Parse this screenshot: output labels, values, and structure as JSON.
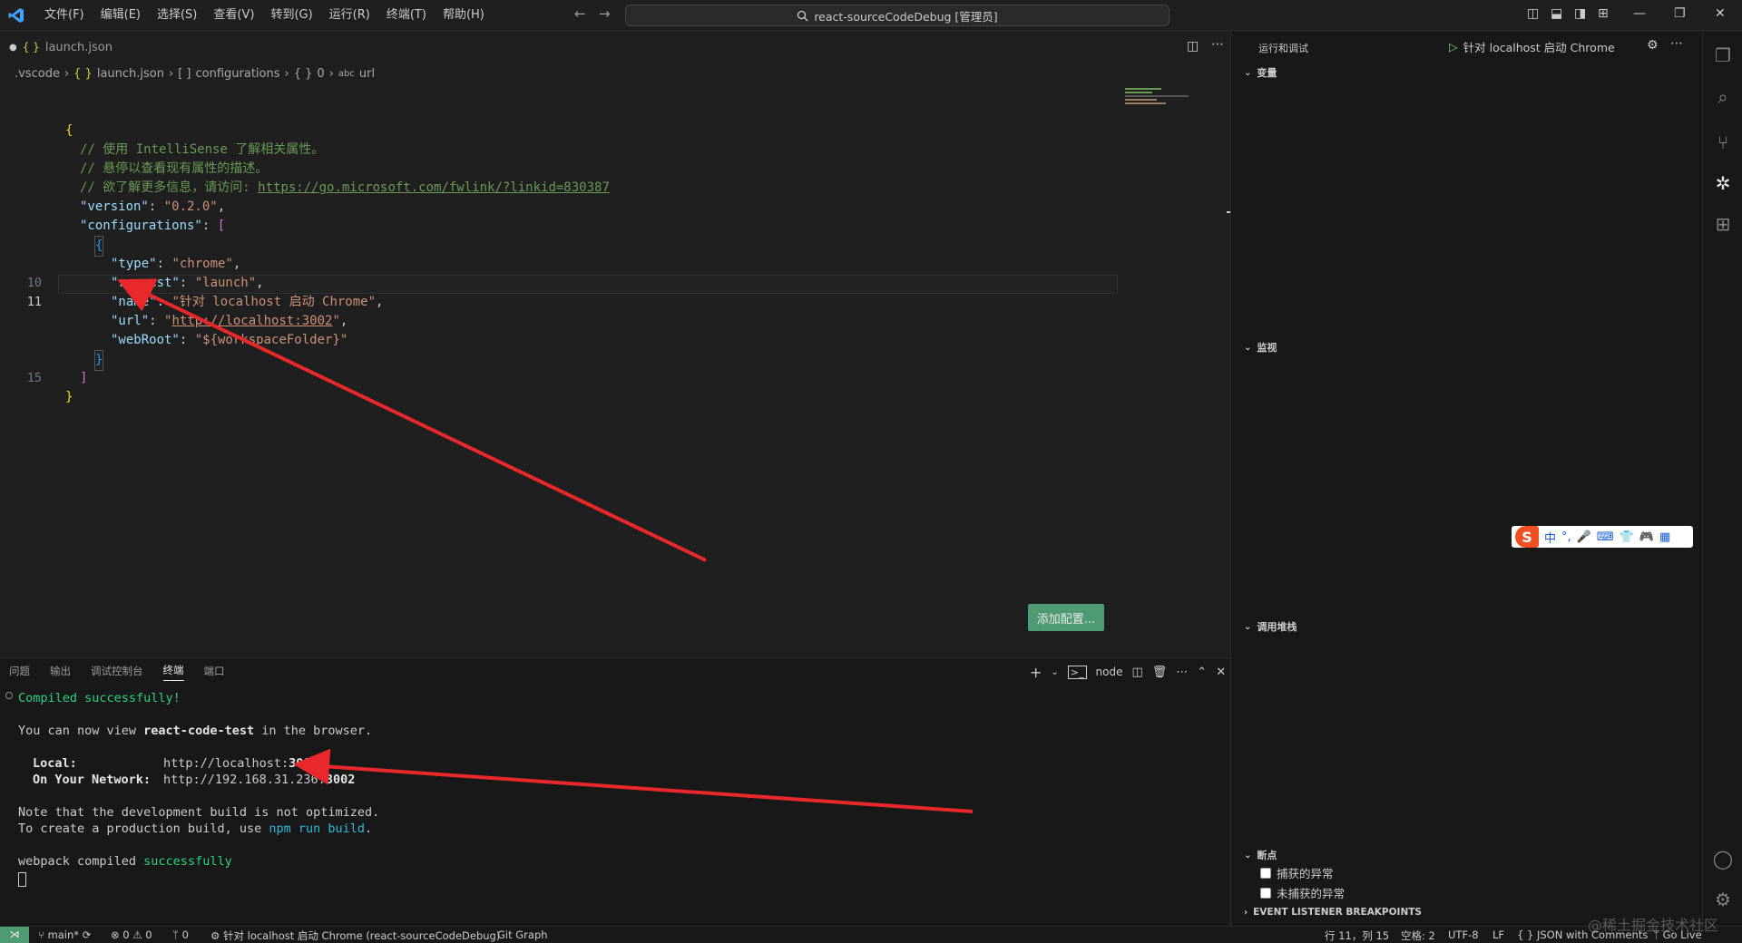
{
  "titlebar": {
    "menu": [
      "文件(F)",
      "编辑(E)",
      "选择(S)",
      "查看(V)",
      "转到(G)",
      "运行(R)",
      "终端(T)",
      "帮助(H)"
    ],
    "search_text": "react-sourceCodeDebug [管理员]"
  },
  "editor": {
    "tab_label": "launch.json",
    "breadcrumb": [
      ".vscode",
      "launch.json",
      "configurations",
      "0",
      "url"
    ],
    "add_config_label": "添加配置...",
    "lines": [
      {
        "ln": "",
        "text": "{"
      },
      {
        "ln": "",
        "text": "// 使用 IntelliSense 了解相关属性。"
      },
      {
        "ln": "",
        "text": "// 悬停以查看现有属性的描述。"
      },
      {
        "ln": "",
        "text": "// 欲了解更多信息，请访问: ",
        "link": "https://go.microsoft.com/fwlink/?linkid=830387"
      },
      {
        "ln": "",
        "key": "\"version\"",
        "value": "\"0.2.0\""
      },
      {
        "ln": "",
        "key": "\"configurations\"",
        "open": "["
      },
      {
        "ln": "",
        "text": "{"
      },
      {
        "ln": "",
        "key": "\"type\"",
        "value": "\"chrome\""
      },
      {
        "ln": "",
        "key": "\"request\"",
        "value": "\"launch\""
      },
      {
        "ln": "10",
        "key": "\"name\"",
        "value": "\"针对 localhost 启动 Chrome\""
      },
      {
        "ln": "11",
        "key": "\"url\"",
        "value": "http://localhost:3002"
      },
      {
        "ln": "",
        "key": "\"webRoot\"",
        "value": "\"${workspaceFolder}\""
      },
      {
        "ln": "",
        "text": "}"
      },
      {
        "ln": "",
        "text": "]"
      },
      {
        "ln": "15",
        "text": "}"
      }
    ]
  },
  "panel": {
    "tabs": [
      "问题",
      "输出",
      "调试控制台",
      "终端",
      "端口"
    ],
    "active_tab": "终端",
    "shell": "node",
    "terminal": {
      "compiled": "Compiled successfully!",
      "view_prefix": "You can now view ",
      "app_name": "react-code-test",
      "view_suffix": " in the browser.",
      "local_label": "Local:",
      "local_url_prefix": "http://localhost:",
      "local_port": "3002",
      "network_label": "On Your Network:",
      "network_url_prefix": "http://192.168.31.236:",
      "network_port": "3002",
      "note1": "Note that the development build is not optimized.",
      "note2_prefix": "To create a production build, use ",
      "note2_cmd": "npm run build",
      "note2_suffix": ".",
      "webpack_prefix": "webpack compiled ",
      "webpack_success": "successfully"
    }
  },
  "sidebar": {
    "title": "运行和调试",
    "run_config": "针对 localhost 启动 Chrome",
    "sections": {
      "variables": "变量",
      "watch": "监视",
      "callstack": "调用堆栈",
      "breakpoints": "断点",
      "bp_caught": "捕获的异常",
      "bp_uncaught": "未捕获的异常",
      "event_listener": "EVENT LISTENER BREAKPOINTS"
    }
  },
  "statusbar": {
    "branch": "main*",
    "errors": "0",
    "warnings": "0",
    "ports": "0",
    "debug": "针对 localhost 启动 Chrome (react-sourceCodeDebug)",
    "git_graph": "Git Graph",
    "position": "行 11，列 15",
    "spaces": "空格: 2",
    "encoding": "UTF-8",
    "eol": "LF",
    "language": "JSON with Comments",
    "golive": "Go Live"
  },
  "ime": {
    "lang": "中"
  },
  "watermark": "@稀土掘金技术社区",
  "colors": {
    "accent_green": "#4e9a72",
    "arrow": "#e8282b",
    "terminal_green": "#23d18b"
  }
}
